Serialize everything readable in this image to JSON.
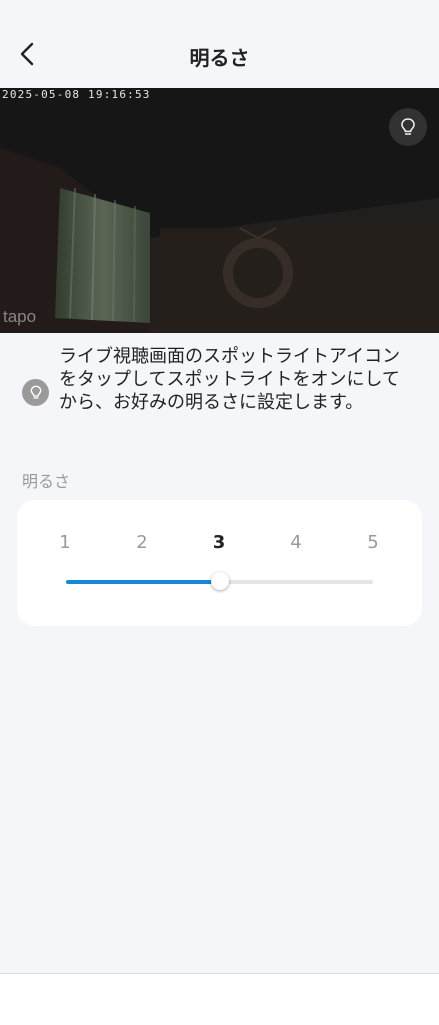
{
  "header": {
    "title": "明るさ",
    "back_icon": "chevron-left-icon"
  },
  "video": {
    "timestamp": "2025-05-08  19:16:53",
    "watermark": "tapo",
    "light_toggle_icon": "lightbulb-icon"
  },
  "hint": {
    "icon": "lightbulb-icon",
    "text": "ライブ視聴画面のスポットライトアイコンをタップしてスポットライトをオンにしてから、お好みの明るさに設定します。"
  },
  "brightness": {
    "section_label": "明るさ",
    "levels": [
      "1",
      "2",
      "3",
      "4",
      "5"
    ],
    "selected_level": 3,
    "accent_color": "#1a86d8"
  }
}
